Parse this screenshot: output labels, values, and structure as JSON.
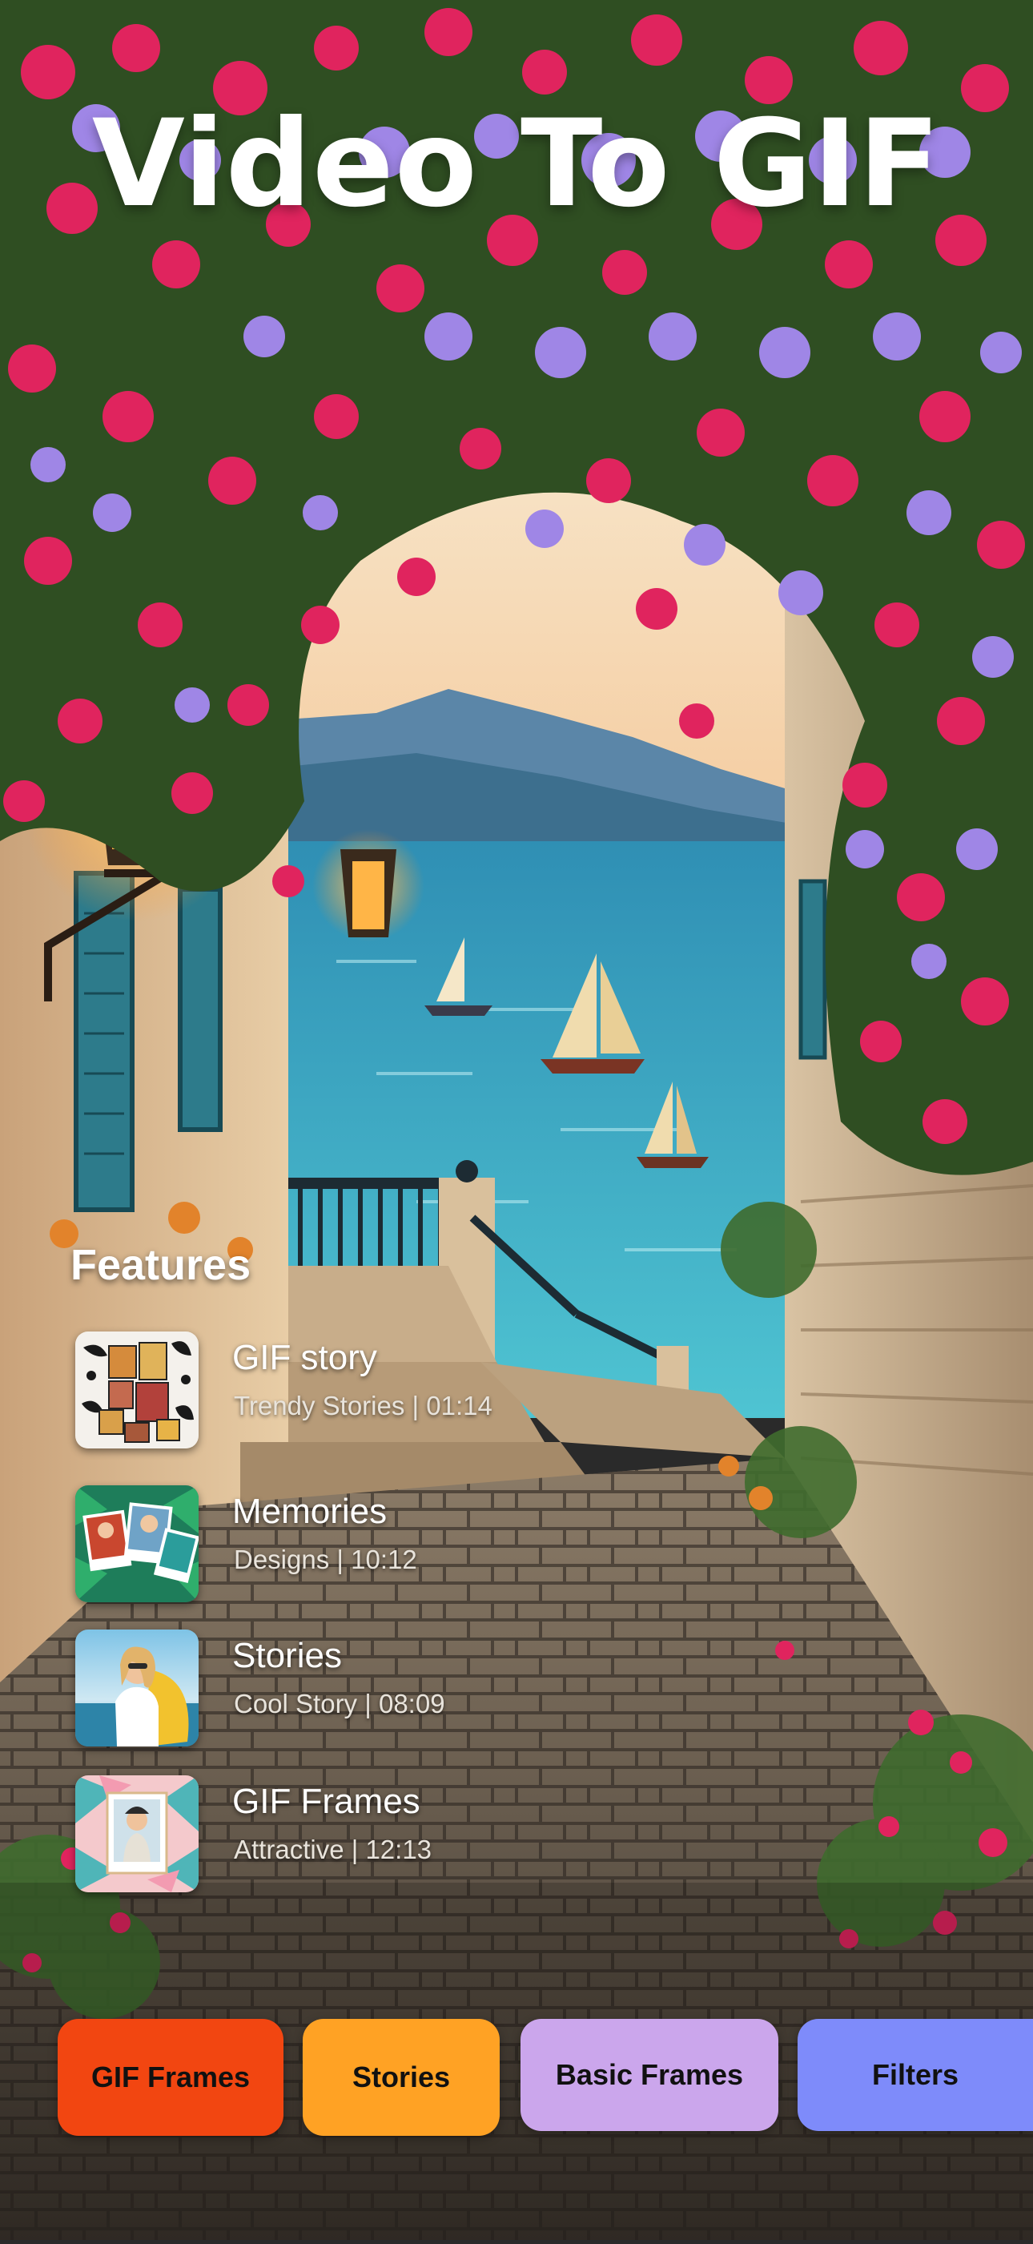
{
  "app": {
    "title": "Video To GIF"
  },
  "features": {
    "heading": "Features",
    "items": [
      {
        "title": "GIF story",
        "subtitle": "Trendy Stories | 01:14",
        "icon": "gif-story-collage-thumbnail"
      },
      {
        "title": "Memories",
        "subtitle": "Designs | 10:12",
        "icon": "memories-photo-thumbnail"
      },
      {
        "title": "Stories",
        "subtitle": "Cool Story | 08:09",
        "icon": "stories-portrait-thumbnail"
      },
      {
        "title": "GIF Frames",
        "subtitle": "Attractive | 12:13",
        "icon": "gif-frames-thumbnail"
      }
    ]
  },
  "tabs": [
    {
      "label": "GIF Frames",
      "color": "#F24611"
    },
    {
      "label": "Stories",
      "color": "#FFA224"
    },
    {
      "label": "Basic Frames",
      "color": "#CBA6EC"
    },
    {
      "label": "Filters",
      "color": "#7E8BFA"
    }
  ],
  "background": {
    "description_icon": "coastal-alley-flowers-background",
    "colors": {
      "sky": "#F6D9B5",
      "sea": "#3FB3C8",
      "flower_pink": "#E0245E",
      "flower_purple": "#9F86E6",
      "stone": "#7C6E5E"
    }
  }
}
